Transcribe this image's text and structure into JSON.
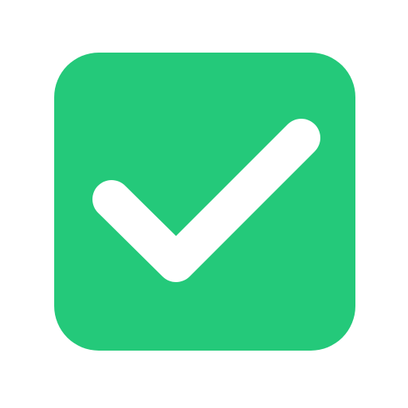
{
  "icon": {
    "name": "checkbox-checked-icon",
    "checked": true,
    "colors": {
      "background": "#ffffff",
      "tile": "#24C97A",
      "check": "#ffffff"
    }
  }
}
